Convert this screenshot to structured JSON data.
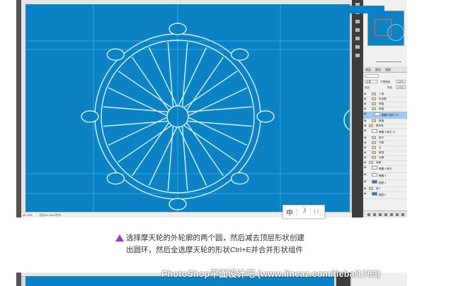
{
  "statusbar": {
    "zoom": "66.78%",
    "doc": "文档:54.4K/0字节"
  },
  "right_panel": {
    "zoom_value": "100.00%",
    "tabs": [
      "图层",
      "路径",
      "通道"
    ],
    "blend_mode": "正常",
    "opacity_label": "不透明度:",
    "opacity_value": "100%",
    "lock_label": "锁定:",
    "fill_label": "填充:",
    "fill_value": "100%",
    "layers": [
      {
        "name": "八角",
        "indent": 1,
        "type": "group"
      },
      {
        "name": "光点圈",
        "indent": 1,
        "type": "group"
      },
      {
        "name": "吊篮",
        "indent": 1,
        "type": "group"
      },
      {
        "name": "转盘",
        "indent": 1,
        "type": "group"
      },
      {
        "name": "椭圆 3 拷贝 13",
        "indent": 2,
        "type": "shape",
        "selected": true
      },
      {
        "name": "转盘",
        "indent": 1,
        "type": "group"
      },
      {
        "name": "摩天轮",
        "indent": 0,
        "type": "group"
      },
      {
        "name": "椭圆 3 拷贝 12",
        "indent": 1,
        "type": "shape"
      },
      {
        "name": "房子",
        "indent": 1,
        "type": "group"
      },
      {
        "name": "气氛",
        "indent": 1,
        "type": "group"
      },
      {
        "name": "云",
        "indent": 1,
        "type": "group"
      },
      {
        "name": "楼顶",
        "indent": 1,
        "type": "group"
      },
      {
        "name": "大楼",
        "indent": 1,
        "type": "group"
      },
      {
        "name": "背景",
        "indent": 0,
        "type": "group"
      },
      {
        "name": "椭圆 3 拷贝",
        "indent": 1,
        "type": "shape"
      },
      {
        "name": "椭圆 3",
        "indent": 1,
        "type": "shape"
      },
      {
        "name": "图层 1",
        "indent": 1,
        "type": "fill"
      },
      {
        "name": "组 1",
        "indent": 0,
        "type": "group"
      },
      {
        "name": "图层 0",
        "indent": 1,
        "type": "fill"
      }
    ]
  },
  "ime_toolbar": {
    "lang": "中",
    "moon": "☽",
    "extra": "⁝ ⁝"
  },
  "caption": {
    "line1": "选择摩天轮的外轮廓的两个圆，然后减去顶层形状创建",
    "line2": "出圆环，然后全选摩天轮的形状Ctrl+E并合并形状组件"
  },
  "watermark": "PhotoShop平面设计吧 (www.lineaz.com/tieba/1783)",
  "colors": {
    "canvas": "#0a82c4",
    "shape_stroke": "#d9f1ff",
    "guide": "#3fc3ff",
    "caption_arrow": "#9b3ec8",
    "selected_layer": "#9fc8ee"
  }
}
